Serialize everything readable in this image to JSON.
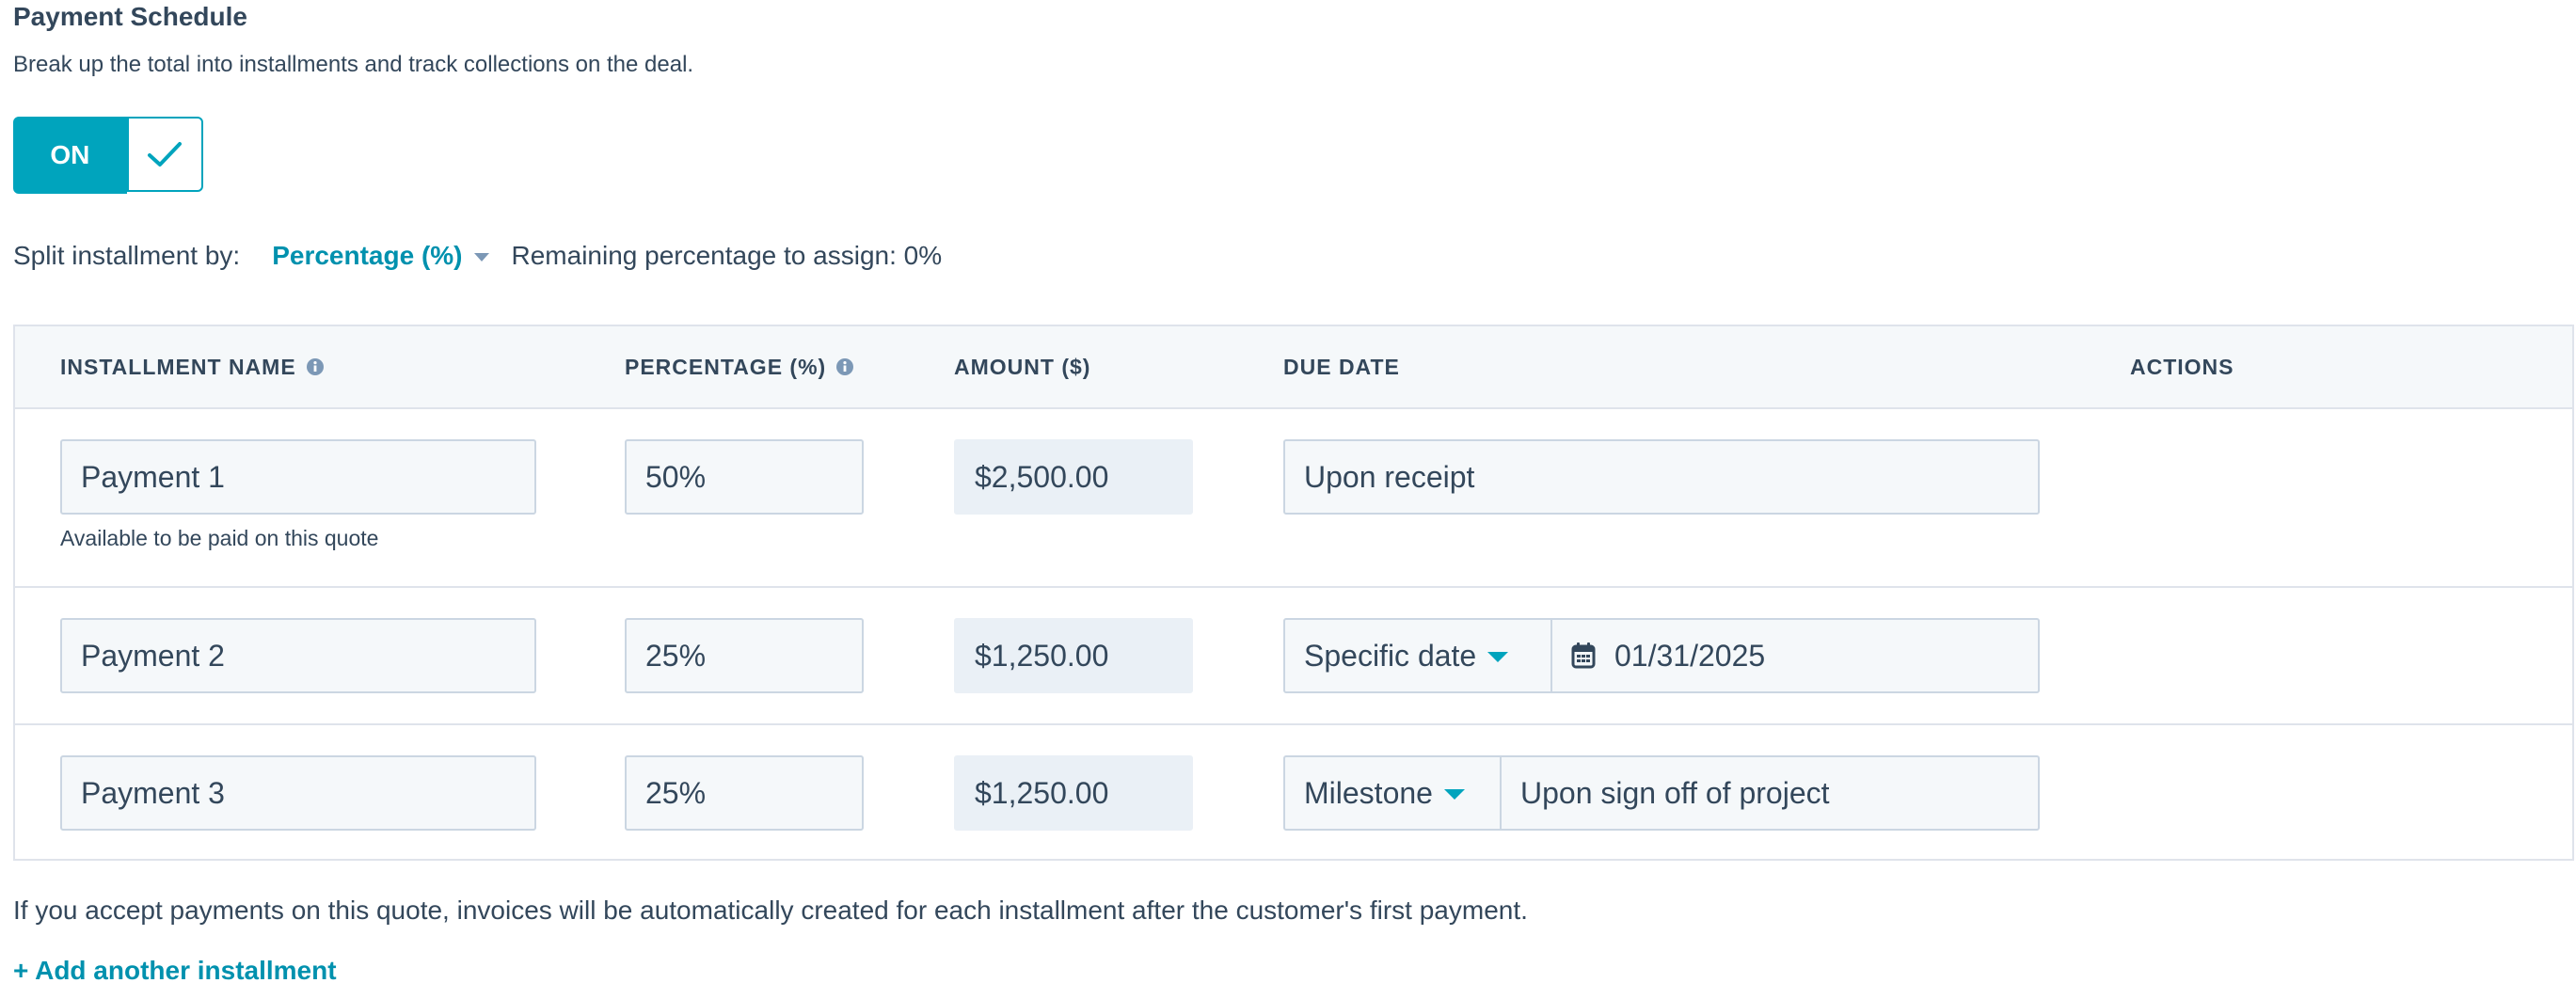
{
  "section": {
    "title": "Payment Schedule",
    "description": "Break up the total into installments and track collections on the deal."
  },
  "toggle": {
    "label": "ON",
    "checked": true,
    "icon": "check-icon"
  },
  "split": {
    "label": "Split installment by:",
    "selected": "Percentage (%)",
    "remaining": "Remaining percentage to assign: 0%"
  },
  "table": {
    "headers": {
      "name": "INSTALLMENT NAME",
      "percentage": "PERCENTAGE (%)",
      "amount": "AMOUNT ($)",
      "due_date": "DUE DATE",
      "actions": "ACTIONS"
    },
    "rows": [
      {
        "name": "Payment 1",
        "percentage": "50%",
        "amount": "$2,500.00",
        "due": "Upon receipt",
        "helper": "Available to be paid on this quote"
      },
      {
        "name": "Payment 2",
        "percentage": "25%",
        "amount": "$1,250.00",
        "due_type": "Specific date",
        "due_value": "01/31/2025"
      },
      {
        "name": "Payment 3",
        "percentage": "25%",
        "amount": "$1,250.00",
        "due_type": "Milestone",
        "due_value": "Upon sign off of project"
      }
    ]
  },
  "footnote": "If you accept payments on this quote, invoices will be automatically created for each installment after the customer's first payment.",
  "add_link": "+ Add another installment",
  "colors": {
    "accent": "#00a4bd",
    "link": "#0091ae",
    "text": "#33475b",
    "border": "#cbd6e2",
    "header_bg": "#f5f8fa"
  }
}
